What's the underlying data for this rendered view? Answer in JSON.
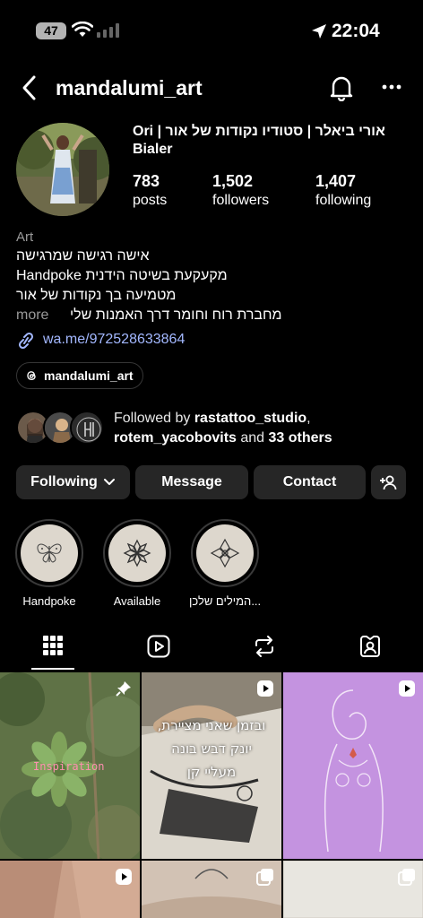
{
  "status_bar": {
    "battery": "47",
    "time": "22:04"
  },
  "nav": {
    "username": "mandalumi_art",
    "back_icon": "chevron-left-icon",
    "bell_icon": "bell-icon",
    "more_icon": "more-horizontal-icon"
  },
  "profile": {
    "full_name": "Ori | אורי ביאלר | סטודיו נקודות של אור Bialer",
    "stats": [
      {
        "value": "783",
        "label": "posts"
      },
      {
        "value": "1,502",
        "label": "followers"
      },
      {
        "value": "1,407",
        "label": "following"
      }
    ],
    "category": "Art",
    "bio_lines": [
      "אישה רגישה שמרגישה",
      "Handpoke מקעקעת בשיטה הידנית",
      "מטמיעה בך נקודות של אור",
      "מחברת רוח וחומר דרך האמנות שלי"
    ],
    "more": "more",
    "link": "wa.me/972528633864",
    "threads_handle": "mandalumi_art"
  },
  "followed_by": {
    "prefix": "Followed by ",
    "user1": "rastattoo_studio",
    "sep": ",",
    "user2": "rotem_yacobovits",
    "mid": " and ",
    "others": "33 others"
  },
  "buttons": {
    "following": "Following",
    "message": "Message",
    "contact": "Contact"
  },
  "highlights": [
    {
      "label": "Handpoke"
    },
    {
      "label": "Available"
    },
    {
      "label": "המילים שלכן..."
    }
  ],
  "tabs": [
    "grid-icon",
    "reels-icon",
    "reposts-icon",
    "tagged-icon"
  ],
  "posts": [
    {
      "overlay_text": "Inspiration",
      "badge": "pin-icon"
    },
    {
      "overlay_text": "ובזמן שאני מציירת, יונק דבש בונה מעליי קן",
      "badge": "reel-icon"
    },
    {
      "overlay_text": "",
      "badge": "reel-icon"
    }
  ],
  "colors": {
    "background": "#000000",
    "button": "#262626",
    "link": "#a3b8ff",
    "muted": "#9a9a9a"
  }
}
